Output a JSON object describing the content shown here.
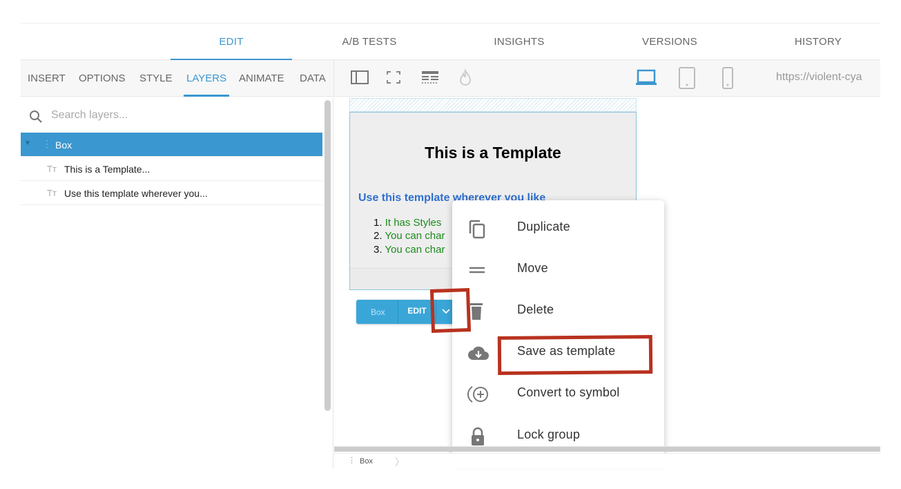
{
  "top_tabs": [
    "EDIT",
    "A/B TESTS",
    "INSIGHTS",
    "VERSIONS",
    "HISTORY"
  ],
  "active_top_tab": "EDIT",
  "left_tabs": [
    "INSERT",
    "OPTIONS",
    "STYLE",
    "LAYERS",
    "ANIMATE",
    "DATA"
  ],
  "active_left_tab": "LAYERS",
  "toolbar": {
    "icons": [
      "sidebar-toggle-icon",
      "fullscreen-icon",
      "grid-layout-icon",
      "flame-icon"
    ],
    "devices": [
      "laptop-icon",
      "tablet-icon",
      "phone-icon"
    ],
    "active_device": "laptop",
    "url": "https://violent-cya"
  },
  "layers": {
    "search_placeholder": "Search layers...",
    "items": [
      {
        "label": "Box",
        "selected": true
      },
      {
        "label": "This is a Template..."
      },
      {
        "label": "Use this template wherever you..."
      }
    ]
  },
  "canvas": {
    "title": "This is a Template",
    "subtitle": "Use this template wherever you like",
    "list": [
      {
        "num": "1.",
        "text": "It has Styles"
      },
      {
        "num": "2.",
        "text": "You can char"
      },
      {
        "num": "3.",
        "text": "You can char"
      }
    ]
  },
  "element_bar": {
    "name": "Box",
    "edit": "EDIT"
  },
  "context_menu": [
    {
      "label": "Duplicate",
      "icon": "copy-icon"
    },
    {
      "label": "Move",
      "icon": "drag-handle-icon"
    },
    {
      "label": "Delete",
      "icon": "trash-icon"
    },
    {
      "label": "Save as template",
      "icon": "cloud-download-icon"
    },
    {
      "label": "Convert to symbol",
      "icon": "add-symbol-icon"
    },
    {
      "label": "Lock group",
      "icon": "lock-icon"
    }
  ],
  "breadcrumb": "Box",
  "colors": {
    "accent": "#3a97cf",
    "annotation": "#b8321f"
  }
}
